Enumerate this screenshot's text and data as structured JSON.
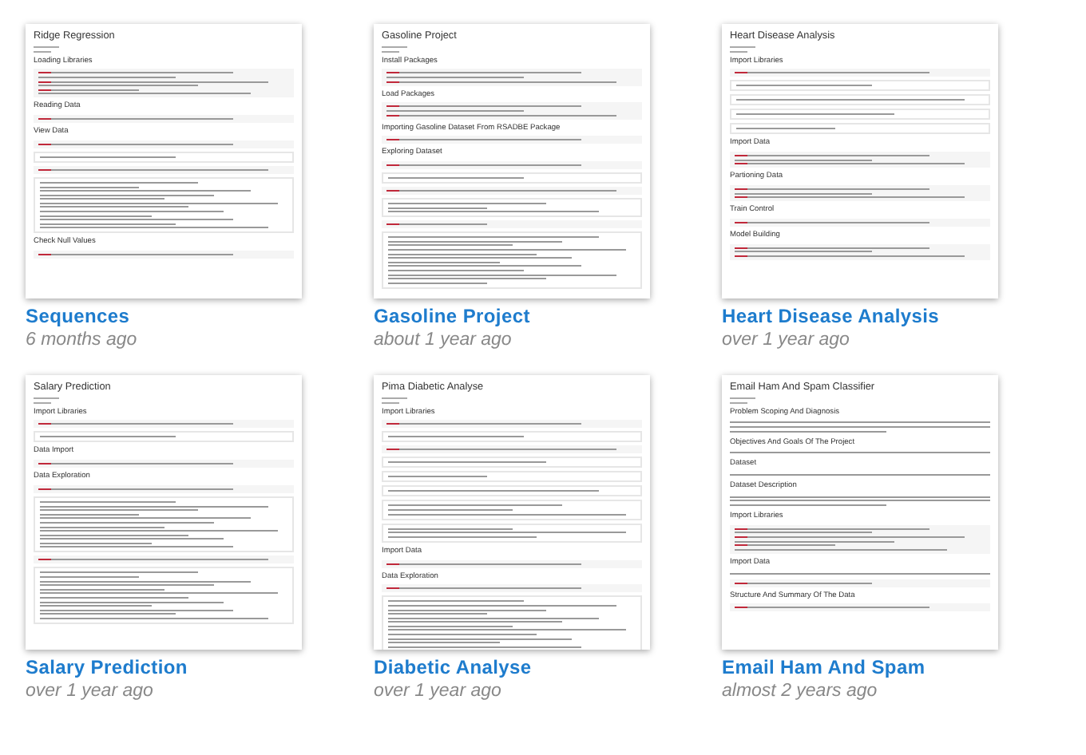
{
  "projects": [
    {
      "title": "Sequences",
      "time": "6 months ago",
      "document": {
        "title": "Ridge Regression",
        "sections": [
          {
            "heading": "Loading Libraries",
            "blocks": [
              {
                "kind": "listing"
              }
            ]
          },
          {
            "heading": "Reading Data",
            "blocks": [
              {
                "kind": "snippet"
              }
            ]
          },
          {
            "heading": "View Data",
            "blocks": [
              {
                "kind": "snippet"
              },
              {
                "kind": "message"
              },
              {
                "kind": "snippet"
              },
              {
                "kind": "table"
              }
            ]
          },
          {
            "heading": "Check Null Values",
            "blocks": [
              {
                "kind": "snippet"
              }
            ]
          }
        ]
      }
    },
    {
      "title": "Gasoline Project",
      "time": "about 1 year ago",
      "document": {
        "title": "Gasoline Project",
        "sections": [
          {
            "heading": "Install Packages",
            "blocks": [
              {
                "kind": "code"
              }
            ]
          },
          {
            "heading": "Load Packages",
            "blocks": [
              {
                "kind": "code"
              }
            ]
          },
          {
            "heading": "Importing Gasoline Dataset From RSADBE Package",
            "blocks": [
              {
                "kind": "snippet"
              }
            ]
          },
          {
            "heading": "Exploring Dataset",
            "blocks": [
              {
                "kind": "snippet"
              },
              {
                "kind": "message"
              },
              {
                "kind": "snippet"
              },
              {
                "kind": "output"
              },
              {
                "kind": "snippet"
              },
              {
                "kind": "table"
              }
            ]
          }
        ]
      }
    },
    {
      "title": "Heart Disease Analysis",
      "time": "over 1 year ago",
      "document": {
        "title": "Heart Disease Analysis",
        "sections": [
          {
            "heading": "Import Libraries",
            "blocks": [
              {
                "kind": "snippet"
              },
              {
                "kind": "message"
              },
              {
                "kind": "message"
              },
              {
                "kind": "message"
              },
              {
                "kind": "message"
              }
            ]
          },
          {
            "heading": "Import Data",
            "blocks": [
              {
                "kind": "code"
              }
            ]
          },
          {
            "heading": "Partioning Data",
            "blocks": [
              {
                "kind": "code"
              }
            ]
          },
          {
            "heading": "Train Control",
            "blocks": [
              {
                "kind": "snippet"
              }
            ]
          },
          {
            "heading": "Model Building",
            "blocks": [
              {
                "kind": "code"
              }
            ]
          }
        ]
      }
    },
    {
      "title": "Salary Prediction",
      "time": "over 1 year ago",
      "document": {
        "title": "Salary Prediction",
        "sections": [
          {
            "heading": "Import Libraries",
            "blocks": [
              {
                "kind": "snippet"
              },
              {
                "kind": "message"
              }
            ]
          },
          {
            "heading": "Data Import",
            "blocks": [
              {
                "kind": "snippet"
              }
            ]
          },
          {
            "heading": "Data Exploration",
            "blocks": [
              {
                "kind": "snippet"
              },
              {
                "kind": "table"
              },
              {
                "kind": "snippet"
              },
              {
                "kind": "table"
              }
            ]
          }
        ]
      }
    },
    {
      "title": "Diabetic Analyse",
      "time": "over 1 year ago",
      "document": {
        "title": "Pima Diabetic Analyse",
        "sections": [
          {
            "heading": "Import Libraries",
            "blocks": [
              {
                "kind": "snippet"
              },
              {
                "kind": "message"
              },
              {
                "kind": "snippet"
              },
              {
                "kind": "message"
              },
              {
                "kind": "message"
              },
              {
                "kind": "message"
              },
              {
                "kind": "output"
              },
              {
                "kind": "output"
              }
            ]
          },
          {
            "heading": "Import Data",
            "blocks": [
              {
                "kind": "snippet"
              }
            ]
          },
          {
            "heading": "Data Exploration",
            "blocks": [
              {
                "kind": "snippet"
              },
              {
                "kind": "table"
              }
            ]
          }
        ]
      }
    },
    {
      "title": "Email Ham And Spam",
      "time": "almost 2 years ago",
      "document": {
        "title": "Email Ham And Spam Classifier",
        "sections": [
          {
            "heading": "Problem Scoping And Diagnosis",
            "blocks": [
              {
                "kind": "paragraph"
              }
            ]
          },
          {
            "heading": "Objectives And Goals Of The Project",
            "blocks": [
              {
                "kind": "note"
              }
            ]
          },
          {
            "heading": "Dataset",
            "blocks": [
              {
                "kind": "note"
              }
            ]
          },
          {
            "heading": "Dataset Description",
            "blocks": [
              {
                "kind": "paragraph"
              }
            ]
          },
          {
            "heading": "Import Libraries",
            "blocks": [
              {
                "kind": "listing"
              }
            ]
          },
          {
            "heading": "Import Data",
            "blocks": [
              {
                "kind": "note"
              },
              {
                "kind": "snippet"
              }
            ]
          },
          {
            "heading": "Structure And Summary Of The Data",
            "blocks": [
              {
                "kind": "snippet"
              }
            ]
          }
        ]
      }
    }
  ]
}
